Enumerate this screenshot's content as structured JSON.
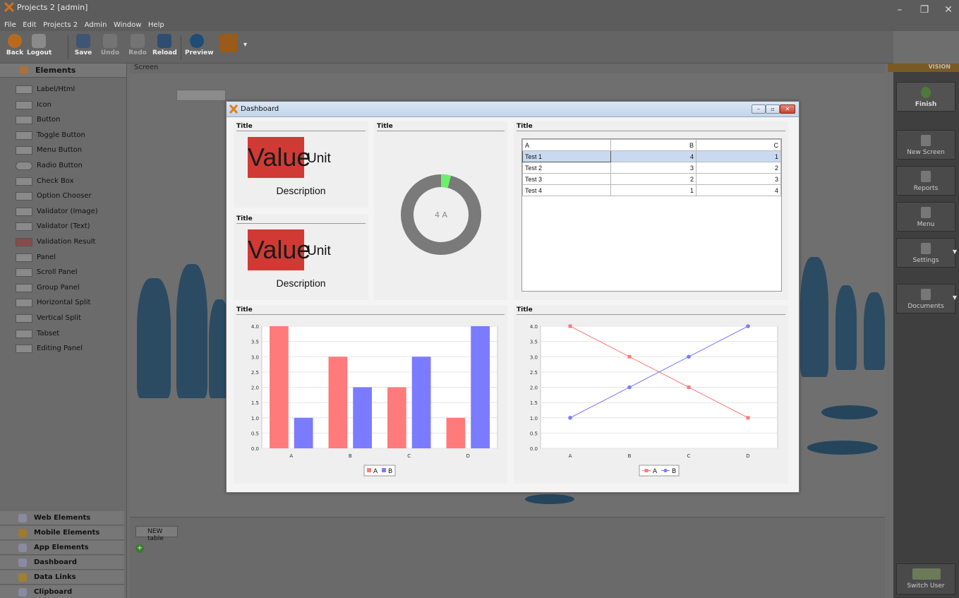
{
  "window": {
    "title": "Projects 2 [admin]",
    "minimize": "–",
    "restore": "❐",
    "close": "✕"
  },
  "menu": [
    "File",
    "Edit",
    "Projects 2",
    "Admin",
    "Window",
    "Help"
  ],
  "toolbar": {
    "back": "Back",
    "logout": "Logout",
    "save": "Save",
    "undo": "Undo",
    "redo": "Redo",
    "reload": "Reload",
    "preview": "Preview",
    "more": "▾"
  },
  "left_panel": {
    "header": "Elements",
    "items": [
      "Label/Html",
      "Icon",
      "Button",
      "Toggle Button",
      "Menu Button",
      "Radio Button",
      "Check Box",
      "Option Chooser",
      "Validator (Image)",
      "Validator (Text)",
      "Validation Result",
      "Panel",
      "Scroll Panel",
      "Group Panel",
      "Horizontal Split",
      "Vertical Split",
      "Tabset",
      "Editing Panel"
    ],
    "bottom_sections": [
      "Web Elements",
      "Mobile Elements",
      "App Elements",
      "Dashboard",
      "Data Links",
      "Clipboard"
    ]
  },
  "workspace": {
    "screen_label": "Screen"
  },
  "bottom_panel": {
    "tab": "NEW table",
    "add": "+"
  },
  "right_panel": {
    "brand": "VISION",
    "buttons": [
      "Finish",
      "New Screen",
      "Reports",
      "Menu",
      "Settings",
      "Documents"
    ],
    "switch_user": "Switch User"
  },
  "dashboard": {
    "title": "Dashboard",
    "value_widgets": [
      {
        "title": "Title",
        "value": "Value",
        "unit": "Unit",
        "description": "Description"
      },
      {
        "title": "Title",
        "value": "Value",
        "unit": "Unit",
        "description": "Description"
      }
    ],
    "donut": {
      "title": "Title",
      "center_label": "4 A",
      "fraction": 0.04
    },
    "table": {
      "title": "Title",
      "columns": [
        "A",
        "B",
        "C"
      ],
      "rows": [
        [
          "Test 1",
          "4",
          "1"
        ],
        [
          "Test 2",
          "3",
          "2"
        ],
        [
          "Test 3",
          "2",
          "3"
        ],
        [
          "Test 4",
          "1",
          "4"
        ]
      ]
    },
    "bar_title": "Title",
    "line_title": "Title",
    "colors": {
      "A": "#ff7b7b",
      "B": "#7b7bff",
      "value_bg": "#d13a34",
      "donut_base": "#7a7a7a",
      "donut_fill": "#6cf06c"
    }
  },
  "chart_data": [
    {
      "type": "bar",
      "categories": [
        "A",
        "B",
        "C",
        "D"
      ],
      "series": [
        {
          "name": "A",
          "values": [
            4,
            3,
            2,
            1
          ]
        },
        {
          "name": "B",
          "values": [
            1,
            2,
            3,
            4
          ]
        }
      ],
      "ylim": [
        0,
        4
      ],
      "yticks": [
        "0.0",
        "0.5",
        "1.0",
        "1.5",
        "2.0",
        "2.5",
        "3.0",
        "3.5",
        "4.0"
      ],
      "legend": "bottom",
      "grid": true
    },
    {
      "type": "line",
      "categories": [
        "A",
        "B",
        "C",
        "D"
      ],
      "series": [
        {
          "name": "A",
          "values": [
            4,
            3,
            2,
            1
          ]
        },
        {
          "name": "B",
          "values": [
            1,
            2,
            3,
            4
          ]
        }
      ],
      "ylim": [
        0,
        4
      ],
      "yticks": [
        "0.0",
        "0.5",
        "1.0",
        "1.5",
        "2.0",
        "2.5",
        "3.0",
        "3.5",
        "4.0"
      ],
      "legend": "bottom",
      "grid": true
    }
  ]
}
